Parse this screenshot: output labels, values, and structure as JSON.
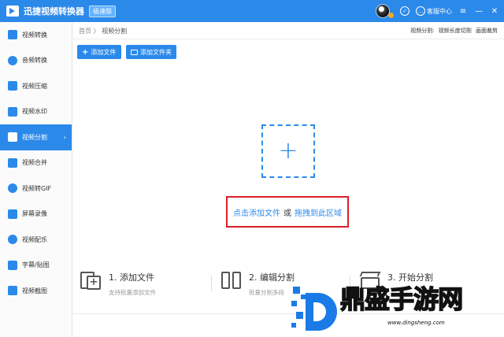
{
  "titlebar": {
    "app_title": "迅捷视频转换器",
    "edition_badge": "极速版",
    "service_label": "客服中心",
    "minimize": "—",
    "close": "✕"
  },
  "sidebar": {
    "items": [
      {
        "label": "视频转换",
        "icon": "video-convert-icon"
      },
      {
        "label": "音频转换",
        "icon": "audio-convert-icon"
      },
      {
        "label": "视频压缩",
        "icon": "video-compress-icon"
      },
      {
        "label": "视频水印",
        "icon": "video-watermark-icon"
      },
      {
        "label": "视频分割",
        "icon": "video-split-icon",
        "active": true
      },
      {
        "label": "视频合并",
        "icon": "video-merge-icon"
      },
      {
        "label": "视频转GIF",
        "icon": "video-gif-icon"
      },
      {
        "label": "屏幕录像",
        "icon": "screen-record-icon"
      },
      {
        "label": "视频配乐",
        "icon": "video-music-icon"
      },
      {
        "label": "字幕/贴图",
        "icon": "subtitle-sticker-icon"
      },
      {
        "label": "视频截图",
        "icon": "video-screenshot-icon"
      }
    ],
    "active_chevron": "›"
  },
  "breadcrumb": {
    "home": "首页",
    "separator": "〉",
    "current": "视频分割"
  },
  "top_tabs": {
    "prefix": "视频分割:",
    "items": [
      "视频长度切割",
      "画面裁剪"
    ]
  },
  "toolbar": {
    "add_file": "添加文件",
    "add_folder": "添加文件夹",
    "plus": "+"
  },
  "dropzone": {
    "plus": "+",
    "click_add": "点击添加文件",
    "or": "或",
    "drag_here": "拖拽到此区域"
  },
  "steps": [
    {
      "title": "1. 添加文件",
      "subtitle": "支持批量添加文件"
    },
    {
      "title": "2. 编辑分割",
      "subtitle": "批量分割多段"
    },
    {
      "title": "3. 开始分割",
      "subtitle": ""
    }
  ],
  "watermark": {
    "text_a": "鼎",
    "text_b": "盛",
    "text_c": "手",
    "text_d": "游",
    "text_e": "网",
    "url": "www.dingsheng.com"
  },
  "colors": {
    "accent": "#2b89ea",
    "highlight_border": "#d92027"
  }
}
